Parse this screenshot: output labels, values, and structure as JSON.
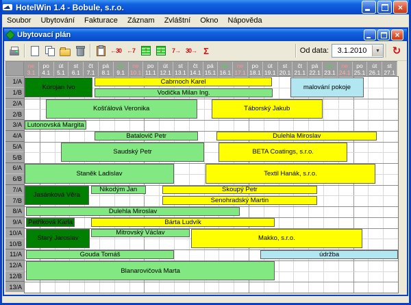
{
  "window": {
    "title": "HotelWin 1.4 - Bobule,  s.r.o."
  },
  "menu": {
    "items": [
      "Soubor",
      "Ubytování",
      "Fakturace",
      "Záznam",
      "Zvláštní",
      "Okno",
      "Nápověda"
    ]
  },
  "plan_window": {
    "title": "Ubytovací plán",
    "toolbar": {
      "buttons": [
        {
          "name": "print",
          "icon": "printer-icon"
        },
        {
          "name": "new",
          "icon": "new-page-icon"
        },
        {
          "name": "copy",
          "icon": "copy-icon"
        },
        {
          "name": "open",
          "icon": "open-folder-icon"
        },
        {
          "name": "delete",
          "icon": "trash-icon"
        },
        {
          "name": "paste",
          "icon": "clipboard-icon"
        },
        {
          "name": "back-30-days",
          "label": "←30"
        },
        {
          "name": "back-7-days",
          "label": "←7"
        },
        {
          "name": "move-up",
          "label": "↑"
        },
        {
          "name": "move-down",
          "label": "↓"
        },
        {
          "name": "forward-7-days",
          "label": "7→"
        },
        {
          "name": "forward-30-days",
          "label": "30→"
        },
        {
          "name": "sum",
          "label": "Σ"
        }
      ],
      "od_data_label": "Od data:",
      "date_value": "3.1.2010",
      "refresh_icon": "↻"
    },
    "calendar": {
      "columns": [
        {
          "day": "ne",
          "date": "3.1"
        },
        {
          "day": "po",
          "date": "4.1"
        },
        {
          "day": "út",
          "date": "5.1"
        },
        {
          "day": "st",
          "date": "6.1"
        },
        {
          "day": "čt",
          "date": "7.1"
        },
        {
          "day": "pá",
          "date": "8.1"
        },
        {
          "day": "so",
          "date": "9.1"
        },
        {
          "day": "ne",
          "date": "10.1"
        },
        {
          "day": "po",
          "date": "11.1"
        },
        {
          "day": "út",
          "date": "12.1"
        },
        {
          "day": "st",
          "date": "13.1"
        },
        {
          "day": "čt",
          "date": "14.1"
        },
        {
          "day": "pá",
          "date": "15.1"
        },
        {
          "day": "so",
          "date": "16.1"
        },
        {
          "day": "ne",
          "date": "17.1"
        },
        {
          "day": "po",
          "date": "18.1"
        },
        {
          "day": "út",
          "date": "19.1"
        },
        {
          "day": "st",
          "date": "20.1"
        },
        {
          "day": "čt",
          "date": "21.1"
        },
        {
          "day": "pá",
          "date": "22.1"
        },
        {
          "day": "so",
          "date": "23.1"
        },
        {
          "day": "ne",
          "date": "24.1"
        },
        {
          "day": "po",
          "date": "25.1"
        },
        {
          "day": "út",
          "date": "26.1"
        },
        {
          "day": "st",
          "date": "27.1"
        }
      ],
      "rooms": [
        "1/A",
        "1/B",
        "2/A",
        "2/B",
        "3/A",
        "4/A",
        "5/A",
        "5/B",
        "6/A",
        "6/B",
        "7/A",
        "7/B",
        "8/A",
        "9/A",
        "10/A",
        "10/B",
        "11/A",
        "12/A",
        "12/B",
        "13/A"
      ],
      "room_group_breaks": [
        2,
        4,
        5,
        6,
        8,
        10,
        12,
        13,
        14,
        16,
        17,
        19
      ],
      "week_start_boundaries": [
        1,
        8,
        15,
        22
      ],
      "colors": {
        "dark_green": "#008000",
        "light_green": "#82E882",
        "yellow": "#FFFF00",
        "cyan": "#B2E6F0"
      },
      "bookings": [
        {
          "room": "1/A+1/B",
          "label": "Korojan Ivo",
          "color": "dark_green",
          "row": 0,
          "span": 2,
          "start": 0,
          "end": 4.55,
          "from": "3.1",
          "to": "7.1"
        },
        {
          "room": "1/A",
          "label": "Cabrnoch Karel",
          "color": "yellow",
          "row": 0,
          "span": 1,
          "start": 4.7,
          "end": 16.55,
          "from": "7.1",
          "to": "19.1"
        },
        {
          "room": "1/B",
          "label": "Vodička Milan Ing.",
          "color": "light_green",
          "row": 1,
          "span": 1,
          "start": 4.7,
          "end": 16.6,
          "from": "7.1",
          "to": "19.1"
        },
        {
          "room": "1/A+1/B",
          "label": "malování pokoje",
          "color": "cyan",
          "row": 0,
          "span": 2,
          "start": 17.8,
          "end": 22.7,
          "from": "20.1",
          "to": "25.1"
        },
        {
          "room": "2/A+2/B",
          "label": "Košťálová Veronika",
          "color": "light_green",
          "row": 2,
          "span": 2,
          "start": 1.4,
          "end": 11.55,
          "from": "4.1",
          "to": "14.1"
        },
        {
          "room": "2/A+2/B",
          "label": "Táborský Jakub",
          "color": "yellow",
          "row": 2,
          "span": 2,
          "start": 12.5,
          "end": 19.95,
          "from": "15.1",
          "to": "23.1"
        },
        {
          "room": "3/A",
          "label": "Lutonovská Margita",
          "color": "light_green",
          "row": 4,
          "span": 1,
          "start": 0,
          "end": 4.15,
          "from": "3.1",
          "to": "7.1"
        },
        {
          "room": "4/A",
          "label": "Batalovič Petr",
          "color": "light_green",
          "row": 5,
          "span": 1,
          "start": 4.7,
          "end": 11.6,
          "from": "7.1",
          "to": "14.1"
        },
        {
          "room": "4/A",
          "label": "Dulehla Miroslav",
          "color": "yellow",
          "row": 5,
          "span": 1,
          "start": 12.85,
          "end": 23.6,
          "from": "15.1",
          "to": "26.1"
        },
        {
          "room": "5/A+5/B",
          "label": "Saudský Petr",
          "color": "light_green",
          "row": 6,
          "span": 2,
          "start": 2.45,
          "end": 12.0,
          "from": "5.1",
          "to": "15.1"
        },
        {
          "room": "5/A+5/B",
          "label": "BETA Coatings, s.r.o.",
          "color": "yellow",
          "row": 6,
          "span": 2,
          "start": 13.0,
          "end": 21.6,
          "from": "16.1",
          "to": "24.1"
        },
        {
          "room": "6/A+6/B",
          "label": "Staněk Ladislav",
          "color": "light_green",
          "row": 8,
          "span": 2,
          "start": 0,
          "end": 10.0,
          "from": "3.1",
          "to": "13.1"
        },
        {
          "room": "6/A+6/B",
          "label": "Textil Hanák, s.r.o.",
          "color": "yellow",
          "row": 8,
          "span": 2,
          "start": 12.1,
          "end": 23.5,
          "from": "15.1",
          "to": "26.1"
        },
        {
          "room": "7/A+7/B",
          "label": "Jasánková Věra",
          "color": "dark_green",
          "row": 10,
          "span": 2,
          "start": 0,
          "end": 4.3,
          "from": "3.1",
          "to": "7.1"
        },
        {
          "room": "7/A",
          "label": "Nikodým Jan",
          "color": "light_green",
          "row": 10,
          "span": 1,
          "start": 4.45,
          "end": 8.1,
          "from": "7.1",
          "to": "11.1"
        },
        {
          "room": "7/A",
          "label": "Skoupý Petr",
          "color": "yellow",
          "row": 10,
          "span": 1,
          "start": 9.2,
          "end": 19.6,
          "from": "12.1",
          "to": "22.1"
        },
        {
          "room": "7/B",
          "label": "Senohradský Martin",
          "color": "yellow",
          "row": 11,
          "span": 1,
          "start": 9.2,
          "end": 19.6,
          "from": "12.1",
          "to": "22.1"
        },
        {
          "room": "8/A",
          "label": "Dulehla Miroslav",
          "color": "light_green",
          "row": 12,
          "span": 1,
          "start": 0.1,
          "end": 14.4,
          "from": "3.1",
          "to": "17.1"
        },
        {
          "room": "9/A",
          "label": "Petříková Karla",
          "color": "dark_green",
          "row": 13,
          "span": 1,
          "start": 0.1,
          "end": 3.35,
          "from": "3.1",
          "to": "6.1"
        },
        {
          "room": "9/A",
          "label": "Bárta Ludvík",
          "color": "yellow",
          "row": 13,
          "span": 1,
          "start": 4.45,
          "end": 16.75,
          "from": "7.1",
          "to": "19.1"
        },
        {
          "room": "10/A+10/B",
          "label": "Starý Jaroslav",
          "color": "dark_green",
          "row": 14,
          "span": 2,
          "start": 0.1,
          "end": 4.35,
          "from": "3.1",
          "to": "7.1"
        },
        {
          "room": "10/A",
          "label": "Mitrovský Václav",
          "color": "light_green",
          "row": 14,
          "span": 1,
          "start": 4.45,
          "end": 11.05,
          "from": "7.1",
          "to": "14.1"
        },
        {
          "room": "10/A+10/B",
          "label": "Makko, s.r.o.",
          "color": "yellow",
          "row": 14,
          "span": 2,
          "start": 11.15,
          "end": 22.6,
          "from": "14.1",
          "to": "25.1"
        },
        {
          "room": "11/A",
          "label": "Gouda Tomáš",
          "color": "light_green",
          "row": 16,
          "span": 1,
          "start": 0.1,
          "end": 10.0,
          "from": "3.1",
          "to": "13.1"
        },
        {
          "room": "11/A",
          "label": "údržba",
          "color": "cyan",
          "row": 16,
          "span": 1,
          "start": 15.8,
          "end": 25.0,
          "from": "18.1",
          "to": "27.1"
        },
        {
          "room": "12/A+12/B",
          "label": "Blanarovičová Marta",
          "color": "light_green",
          "row": 17,
          "span": 2,
          "start": 0.1,
          "end": 16.75,
          "from": "3.1",
          "to": "19.1"
        }
      ]
    }
  }
}
